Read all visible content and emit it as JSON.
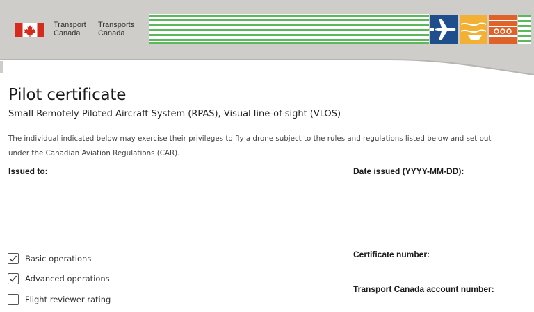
{
  "header": {
    "dept_en_line1": "Transport",
    "dept_en_line2": "Canada",
    "dept_fr_line1": "Transports",
    "dept_fr_line2": "Canada",
    "flag_icon": "canada-flag-icon",
    "mode_icons": [
      "air-mode-icon",
      "marine-mode-icon",
      "rail-mode-icon"
    ],
    "colors": {
      "banner": "#cfcdca",
      "stripes_green": "#5cb85c",
      "air_tile": "#1f4e8c",
      "marine_tile": "#f2b134",
      "rail_tile": "#e0622b",
      "flag_red": "#d52b1e"
    }
  },
  "document": {
    "title": "Pilot certificate",
    "subtitle": "Small Remotely Piloted Aircraft System (RPAS), Visual line-of-sight (VLOS)",
    "intro_line1": "The individual indicated below may exercise their privileges to fly a drone subject to the rules and regulations listed below and set out",
    "intro_line2": "under the Canadian Aviation Regulations (CAR).",
    "issued_to_label": "Issued to:",
    "date_issued_label": "Date issued (YYYY-MM-DD):",
    "certificate_number_label": "Certificate number:",
    "account_number_label": "Transport Canada account number:"
  },
  "privileges": [
    {
      "label": "Basic operations",
      "checked": true
    },
    {
      "label": "Advanced operations",
      "checked": true
    },
    {
      "label": "Flight reviewer rating",
      "checked": false
    }
  ]
}
